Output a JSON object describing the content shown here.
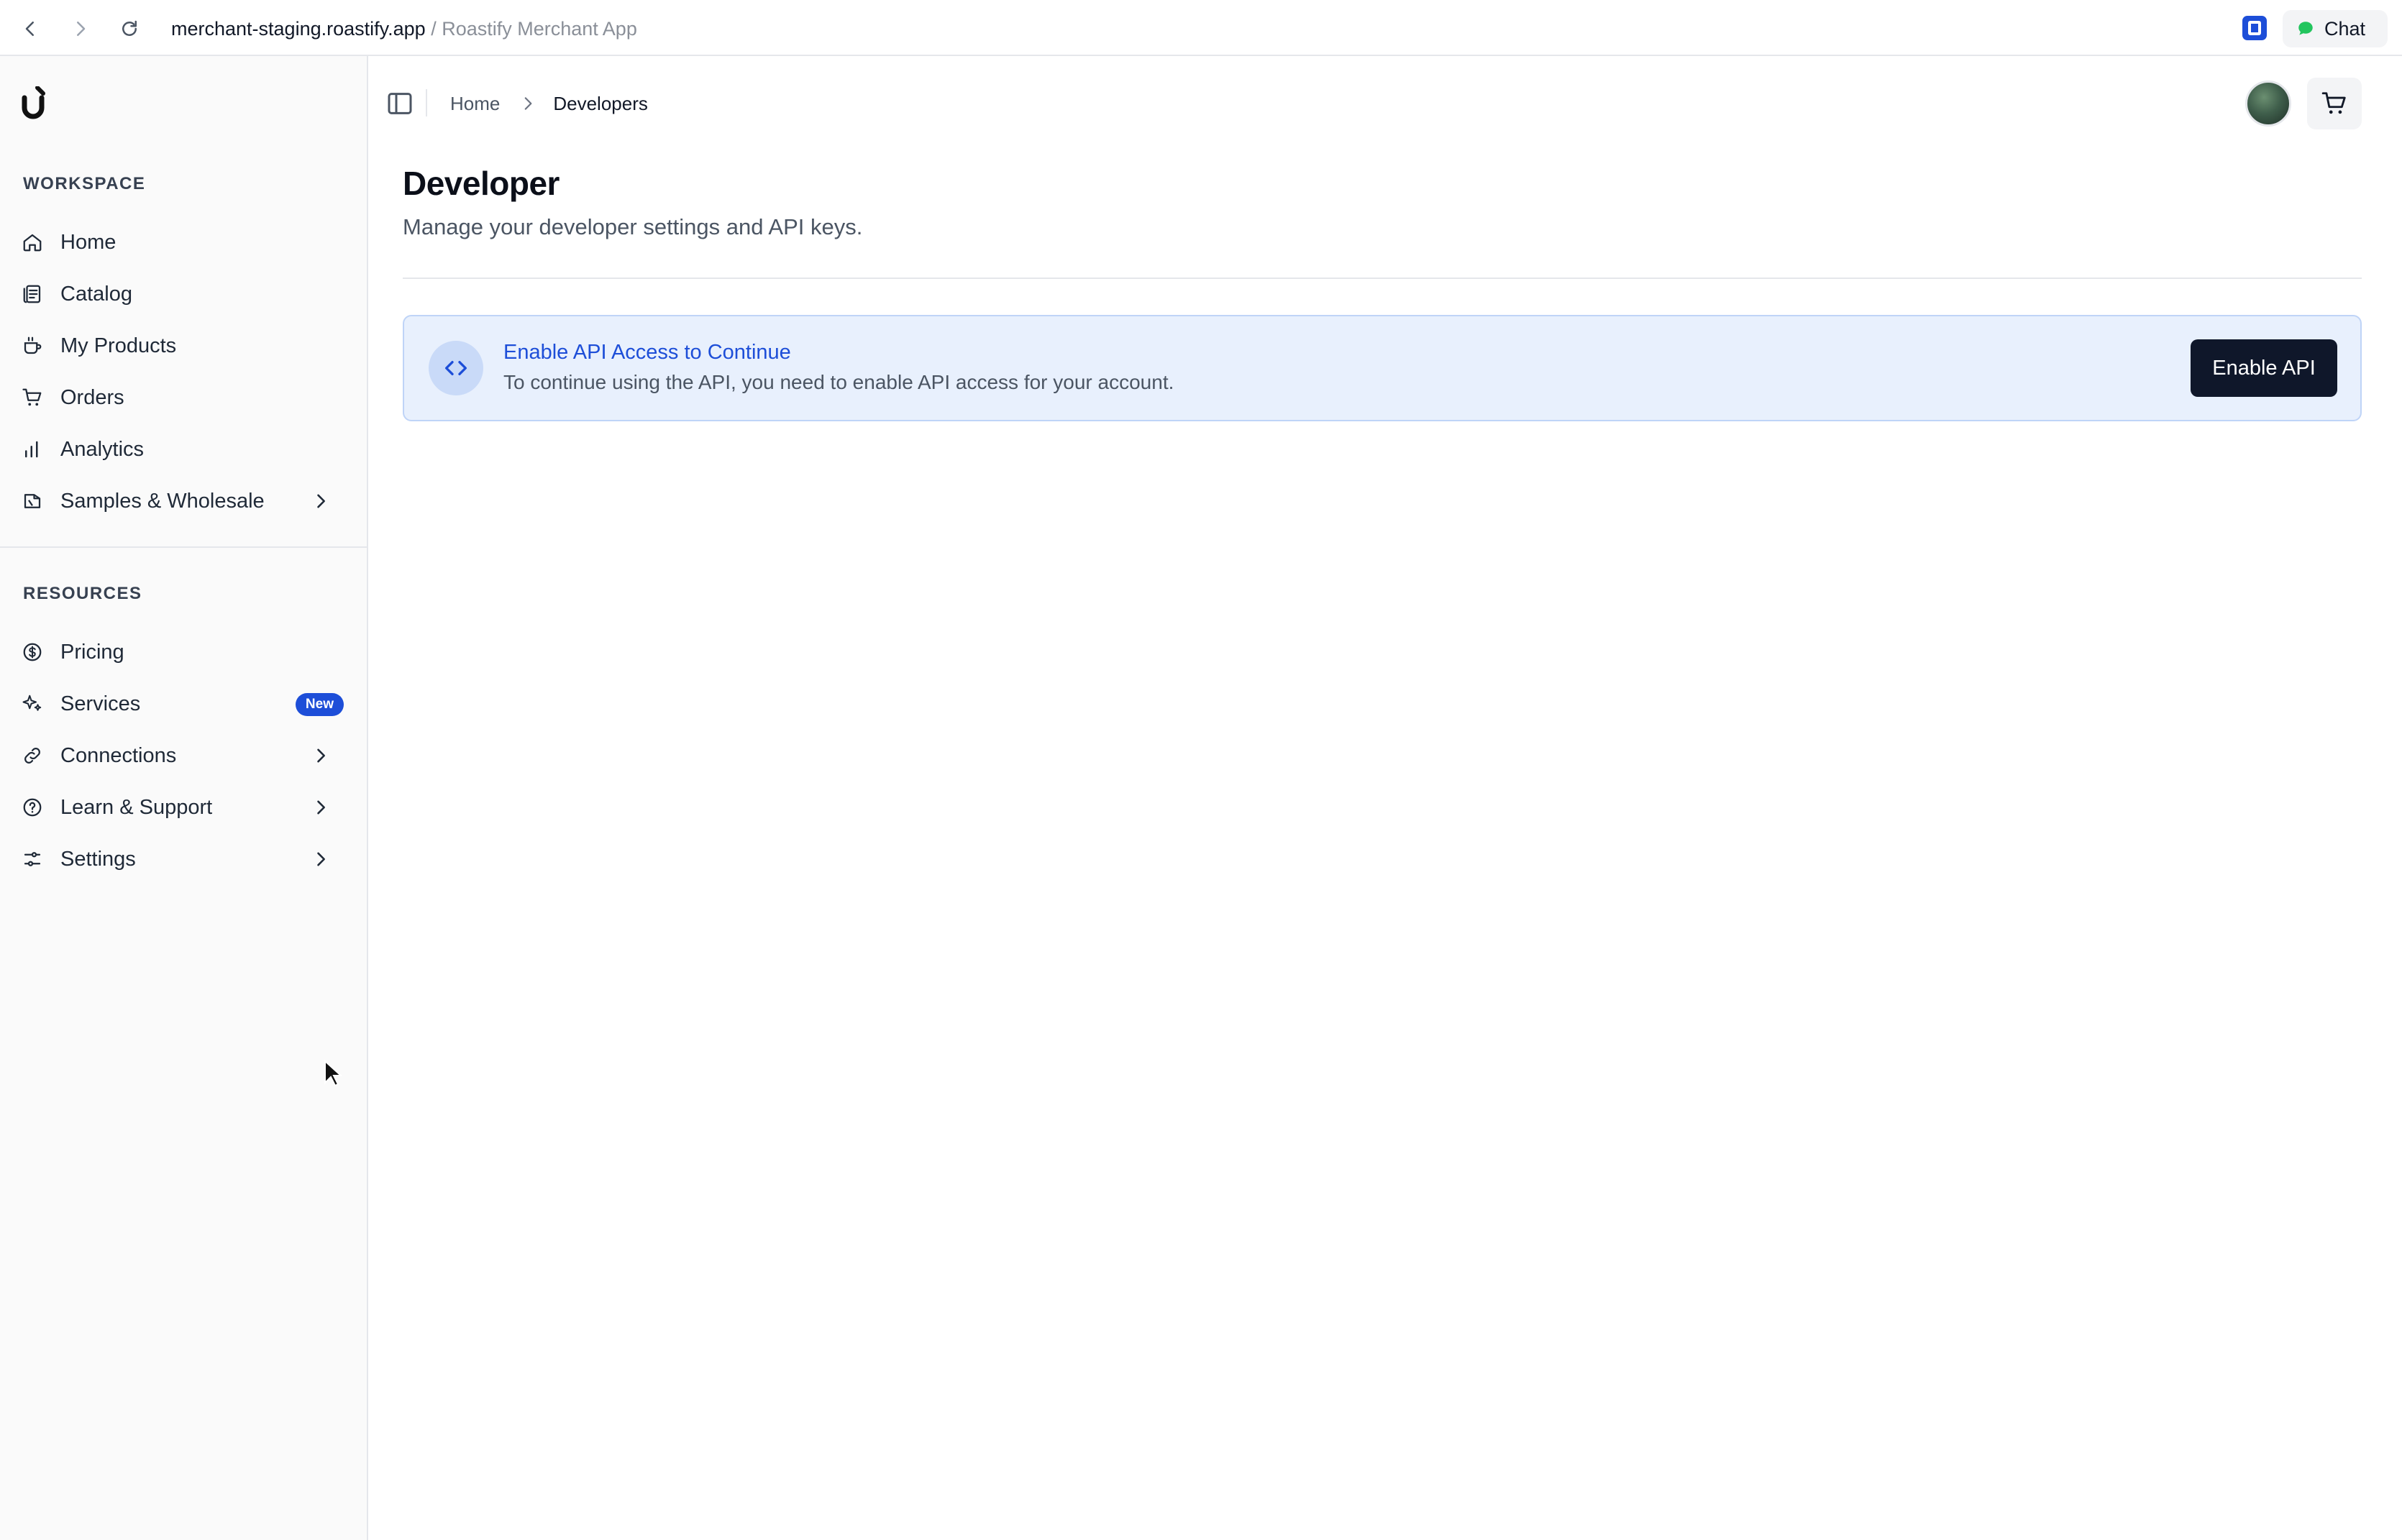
{
  "browser": {
    "url_host": "merchant-staging.roastify.app",
    "url_separator": " / ",
    "tab_title": "Roastify Merchant App",
    "chat_label": "Chat"
  },
  "sidebar": {
    "workspace_title": "WORKSPACE",
    "workspace_items": [
      {
        "label": "Home",
        "icon": "home-icon"
      },
      {
        "label": "Catalog",
        "icon": "catalog-icon"
      },
      {
        "label": "My Products",
        "icon": "coffee-cup-icon"
      },
      {
        "label": "Orders",
        "icon": "cart-icon"
      },
      {
        "label": "Analytics",
        "icon": "bar-chart-icon"
      },
      {
        "label": "Samples & Wholesale",
        "icon": "package-icon",
        "expandable": true
      }
    ],
    "resources_title": "RESOURCES",
    "resource_items": [
      {
        "label": "Pricing",
        "icon": "dollar-circle-icon"
      },
      {
        "label": "Services",
        "icon": "sparkles-icon",
        "badge": "New"
      },
      {
        "label": "Connections",
        "icon": "link-icon",
        "expandable": true
      },
      {
        "label": "Learn & Support",
        "icon": "help-circle-icon",
        "expandable": true
      },
      {
        "label": "Settings",
        "icon": "sliders-icon",
        "expandable": true
      }
    ]
  },
  "breadcrumb": {
    "home": "Home",
    "current": "Developers"
  },
  "page": {
    "title": "Developer",
    "subtitle": "Manage your developer settings and API keys."
  },
  "banner": {
    "title": "Enable API Access to Continue",
    "text": "To continue using the API, you need to enable API access for your account.",
    "button_label": "Enable API"
  },
  "colors": {
    "accent_blue": "#1d4ed8",
    "banner_bg": "#e8f0fd",
    "button_dark": "#0f172a",
    "chat_green": "#22c55e"
  }
}
